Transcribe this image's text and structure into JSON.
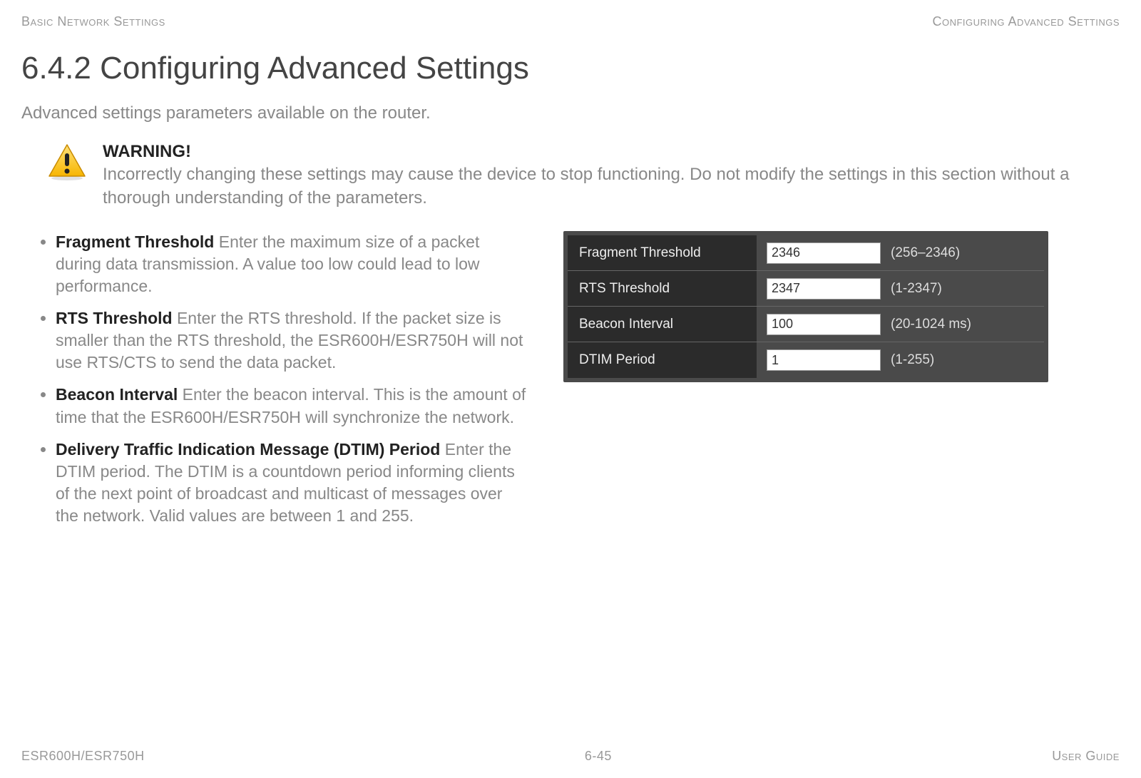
{
  "header": {
    "left": "Basic Network Settings",
    "right": "Configuring Advanced Settings"
  },
  "title": "6.4.2 Configuring Advanced Settings",
  "intro": "Advanced settings parameters available on the router.",
  "warning": {
    "title": "WARNING!",
    "body": "Incorrectly changing these settings may cause the device to stop functioning. Do not modify the settings in this section without a thorough understanding of the parameters."
  },
  "bullets": [
    {
      "term": "Fragment Threshold",
      "desc": "  Enter the maximum size of a packet during data transmission. A value too low could lead to low performance."
    },
    {
      "term": "RTS Threshold",
      "desc": "  Enter the RTS threshold.  If the packet size is smaller than the RTS threshold, the ESR600H/ESR750H will not use RTS/CTS to send the data packet."
    },
    {
      "term": "Beacon Interval",
      "desc": "  Enter the beacon interval. This is the amount of time that the ESR600H/ESR750H will synchronize the network."
    },
    {
      "term": "Delivery Traffic Indication Message (DTIM) Period",
      "desc": "  Enter the DTIM period. The DTIM is a countdown period informing clients of the next point of broadcast and multicast of messages over the network. Valid values are between 1 and 255."
    }
  ],
  "settings": [
    {
      "label": "Fragment Threshold",
      "value": "2346",
      "range": "(256–2346)"
    },
    {
      "label": "RTS Threshold",
      "value": "2347",
      "range": "(1-2347)"
    },
    {
      "label": "Beacon Interval",
      "value": "100",
      "range": "(20-1024 ms)"
    },
    {
      "label": "DTIM Period",
      "value": "1",
      "range": "(1-255)"
    }
  ],
  "footer": {
    "left": "ESR600H/ESR750H",
    "center": "6-45",
    "right": "User Guide"
  }
}
